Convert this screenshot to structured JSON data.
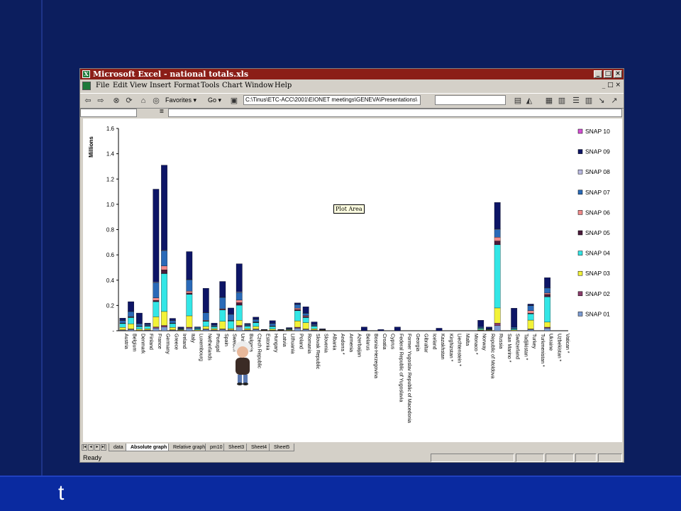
{
  "slide": {
    "footer_text": "t"
  },
  "window": {
    "title": "Microsoft Excel - national totals.xls",
    "controls": [
      "_",
      "□",
      "×"
    ],
    "menu": [
      "File",
      "Edit",
      "View",
      "Insert",
      "Format",
      "Tools",
      "Chart",
      "Window",
      "Help"
    ],
    "doc_controls": "_ □ ×"
  },
  "toolbar": {
    "favorites_label": "Favorites ▾",
    "go_label": "Go ▾",
    "address": "C:\\Tinus\\ETC-ACC\\2001\\EIONET meetings\\GENEVA\\Presentations\\"
  },
  "formula": {
    "equals": "="
  },
  "tooltip": {
    "text": "Plot Area"
  },
  "sheet_tabs": [
    "data",
    "Absolute graph",
    "Relative graph",
    "pm10",
    "Sheet3",
    "Sheet4",
    "Sheet5"
  ],
  "active_tab": "Absolute graph",
  "status": {
    "text": "Ready"
  },
  "chart_data": {
    "type": "bar",
    "stacked": true,
    "ylabel": "Millions",
    "ylim": [
      0,
      1.6
    ],
    "yticks": [
      "-",
      "0.2",
      "0.4",
      "0.6",
      "0.8",
      "1.0",
      "1.2",
      "1.4",
      "1.6"
    ],
    "legend_position": "right",
    "categories": [
      "Austria",
      "Belgium",
      "Denmark",
      "Finland",
      "France",
      "Germany",
      "Greece",
      "Ireland",
      "Italy",
      "Luxembourg",
      "Netherlands",
      "Portugal",
      "Spain",
      "Sweden",
      "United Kingdom",
      "Bulgaria",
      "Czech Republic",
      "Estonia",
      "Hungary",
      "Latvia",
      "Lithuania",
      "Poland",
      "Romania",
      "Slovak Republic",
      "Slovenia",
      "Albania",
      "Andorra *",
      "Armenia",
      "Azerbaijan",
      "Belarus",
      "Bosnia-Herzegovina",
      "Croatia",
      "Cyprus",
      "Federal Republic of Yugoslavia",
      "Former Yugoslav Republic of Macedonia",
      "Georgia",
      "Gibraltar",
      "Iceland",
      "Kazakhstan",
      "Kirghizstan *",
      "Liechtenstein *",
      "Malta",
      "Monaco *",
      "Norway",
      "Republic of Moldova",
      "Russia",
      "San Marino *",
      "Switzerland",
      "Tadjikistan *",
      "Turkey",
      "Turkmenistan *",
      "Ukraine",
      "Uzbekistan *",
      "Vatican *"
    ],
    "series": [
      {
        "name": "SNAP 01",
        "color": "#7b9bd1",
        "values": [
          0.005,
          0.01,
          0.002,
          0.004,
          0.02,
          0.03,
          0.005,
          0.002,
          0.02,
          0.001,
          0.01,
          0.005,
          0.01,
          0.005,
          0.03,
          0.005,
          0.01,
          0.001,
          0.003,
          0.001,
          0.002,
          0.02,
          0.01,
          0.004,
          0.001,
          0,
          0,
          0,
          0,
          0,
          0,
          0,
          0,
          0,
          0,
          0,
          0,
          0,
          0,
          0,
          0,
          0,
          0,
          0.003,
          0.002,
          0.04,
          0,
          0.001,
          0,
          0.01,
          0,
          0.02,
          0,
          0
        ]
      },
      {
        "name": "SNAP 02",
        "color": "#8a3c6b",
        "values": [
          0.002,
          0.004,
          0.001,
          0.002,
          0.01,
          0.012,
          0.002,
          0.001,
          0.008,
          0.0005,
          0.004,
          0.002,
          0.004,
          0.002,
          0.012,
          0.002,
          0.004,
          0.0005,
          0.001,
          0.0005,
          0.001,
          0.008,
          0.004,
          0.002,
          0.0005,
          0,
          0,
          0,
          0,
          0,
          0,
          0,
          0,
          0,
          0,
          0,
          0,
          0,
          0,
          0,
          0,
          0,
          0,
          0.001,
          0.001,
          0.02,
          0,
          0.0005,
          0,
          0.004,
          0,
          0.008,
          0,
          0
        ]
      },
      {
        "name": "SNAP 03",
        "color": "#f2f238",
        "values": [
          0.02,
          0.04,
          0.01,
          0.01,
          0.08,
          0.11,
          0.02,
          0.005,
          0.09,
          0.005,
          0.02,
          0.01,
          0.06,
          0.01,
          0.04,
          0.01,
          0.02,
          0.002,
          0.01,
          0.002,
          0.005,
          0.05,
          0.05,
          0.01,
          0.002,
          0,
          0,
          0,
          0,
          0,
          0,
          0,
          0,
          0,
          0,
          0,
          0,
          0,
          0,
          0,
          0,
          0,
          0,
          0.005,
          0.003,
          0.12,
          0,
          0.005,
          0,
          0.07,
          0,
          0.04,
          0,
          0
        ]
      },
      {
        "name": "SNAP 04",
        "color": "#33e6e6",
        "values": [
          0.03,
          0.05,
          0.02,
          0.02,
          0.12,
          0.3,
          0.03,
          0.005,
          0.17,
          0.01,
          0.04,
          0.015,
          0.09,
          0.06,
          0.12,
          0.02,
          0.03,
          0.002,
          0.02,
          0.002,
          0.005,
          0.08,
          0.04,
          0.02,
          0.003,
          0,
          0,
          0,
          0,
          0,
          0,
          0,
          0,
          0,
          0,
          0,
          0,
          0,
          0,
          0,
          0,
          0,
          0,
          0.01,
          0.005,
          0.5,
          0,
          0.01,
          0,
          0.05,
          0,
          0.2,
          0,
          0
        ]
      },
      {
        "name": "SNAP 05",
        "color": "#4a1a3a",
        "values": [
          0.002,
          0.004,
          0.002,
          0.002,
          0.01,
          0.03,
          0.002,
          0.001,
          0.01,
          0.001,
          0.004,
          0.002,
          0.005,
          0.002,
          0.02,
          0.002,
          0.003,
          0.001,
          0.002,
          0.001,
          0.001,
          0.01,
          0.01,
          0.002,
          0.001,
          0,
          0,
          0,
          0,
          0,
          0,
          0,
          0,
          0,
          0,
          0,
          0,
          0,
          0,
          0,
          0,
          0,
          0,
          0.002,
          0.001,
          0.03,
          0,
          0.001,
          0,
          0.005,
          0,
          0.02,
          0,
          0
        ]
      },
      {
        "name": "SNAP 06",
        "color": "#f08a8a",
        "values": [
          0.002,
          0.004,
          0.001,
          0.002,
          0.02,
          0.03,
          0.002,
          0.001,
          0.015,
          0.001,
          0.004,
          0.002,
          0.005,
          0.002,
          0.02,
          0.002,
          0.003,
          0.001,
          0.002,
          0.001,
          0.001,
          0.01,
          0.005,
          0.002,
          0.001,
          0,
          0,
          0,
          0,
          0,
          0,
          0,
          0,
          0,
          0,
          0,
          0,
          0,
          0,
          0,
          0,
          0,
          0,
          0.002,
          0.001,
          0.03,
          0,
          0.001,
          0,
          0.02,
          0,
          0.01,
          0,
          0
        ]
      },
      {
        "name": "SNAP 07",
        "color": "#2a6ab8",
        "values": [
          0.02,
          0.04,
          0.02,
          0.01,
          0.12,
          0.12,
          0.02,
          0.005,
          0.09,
          0.01,
          0.06,
          0.01,
          0.09,
          0.05,
          0.06,
          0.01,
          0.02,
          0.002,
          0.02,
          0.002,
          0.005,
          0.03,
          0.02,
          0.01,
          0.003,
          0,
          0,
          0,
          0,
          0,
          0,
          0,
          0,
          0,
          0,
          0,
          0,
          0,
          0,
          0,
          0,
          0,
          0,
          0.01,
          0.003,
          0.06,
          0,
          0.01,
          0,
          0.04,
          0,
          0.04,
          0,
          0
        ]
      },
      {
        "name": "SNAP 08",
        "color": "#b9b9e0",
        "values": [
          0.001,
          0.002,
          0.001,
          0.001,
          0.005,
          0.005,
          0.001,
          0,
          0.003,
          0,
          0.002,
          0.001,
          0.002,
          0.001,
          0.005,
          0.001,
          0.001,
          0,
          0.001,
          0,
          0,
          0.002,
          0.001,
          0.001,
          0,
          0,
          0,
          0,
          0,
          0,
          0,
          0,
          0,
          0,
          0,
          0,
          0,
          0,
          0,
          0,
          0,
          0,
          0,
          0,
          0,
          0.005,
          0,
          0,
          0,
          0.002,
          0,
          0.002,
          0,
          0
        ]
      },
      {
        "name": "SNAP 09",
        "color": "#0d1566",
        "values": [
          0.018,
          0.076,
          0.083,
          0.009,
          0.735,
          0.673,
          0.016,
          0.01,
          0.22,
          0.002,
          0.192,
          0.013,
          0.124,
          0.048,
          0.223,
          0.006,
          0.017,
          0.001,
          0.021,
          0.001,
          0.005,
          0.01,
          0.05,
          0.019,
          0.004,
          0,
          0,
          0,
          0,
          0.03,
          0,
          0.01,
          0,
          0.03,
          0,
          0,
          0,
          0,
          0.02,
          0,
          0,
          0,
          0,
          0.05,
          0.014,
          0.21,
          0,
          0.15,
          0,
          0.01,
          0,
          0.08,
          0,
          0
        ]
      },
      {
        "name": "SNAP 10",
        "color": "#d44fd4",
        "values": [
          0,
          0,
          0,
          0,
          0,
          0,
          0,
          0,
          0,
          0,
          0,
          0,
          0,
          0,
          0,
          0,
          0,
          0,
          0,
          0,
          0,
          0,
          0,
          0,
          0,
          0,
          0,
          0,
          0,
          0,
          0,
          0,
          0,
          0,
          0,
          0,
          0,
          0,
          0,
          0,
          0,
          0,
          0,
          0,
          0,
          0,
          0,
          0,
          0,
          0,
          0,
          0,
          0,
          0
        ]
      }
    ]
  }
}
